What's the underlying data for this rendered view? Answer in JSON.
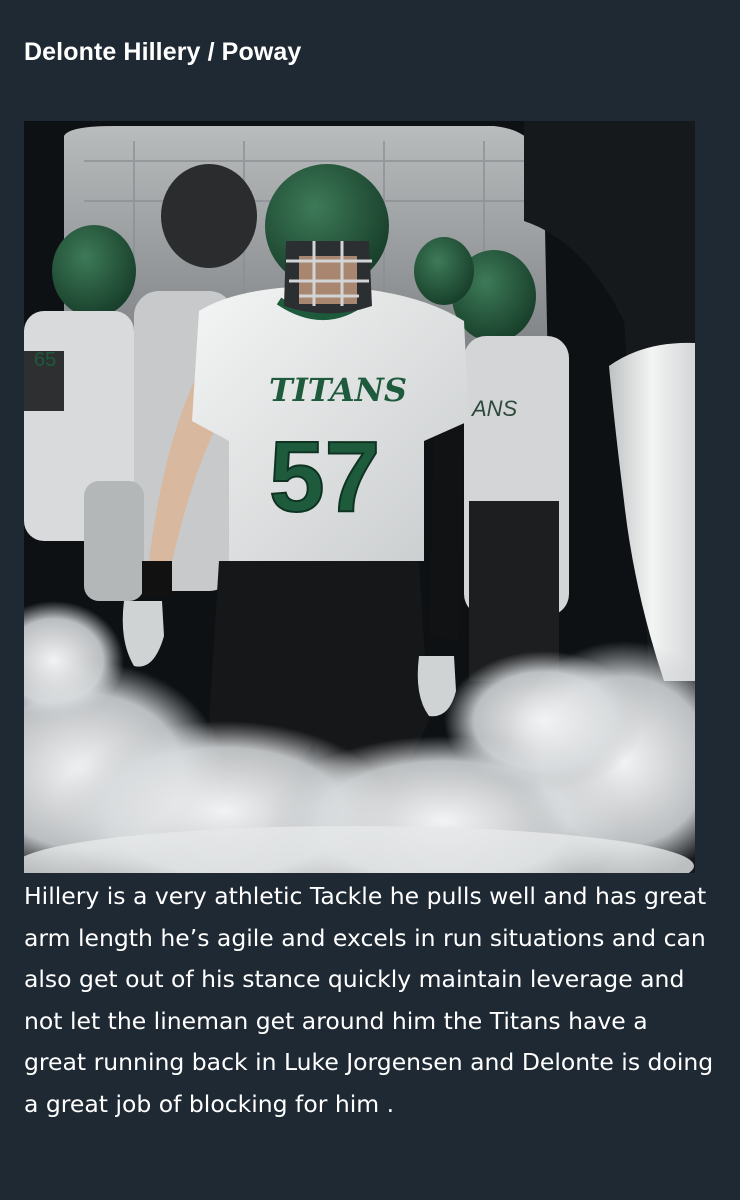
{
  "article": {
    "heading": "Delonte Hillery / Poway",
    "photo": {
      "jersey_text": "TITANS",
      "jersey_number": "57",
      "left_player_number": "65",
      "accent_color": "#1e5a3c"
    },
    "caption": "Hillery is a very athletic Tackle he pulls well and has great arm length he’s agile and excels in run situations and can also get out of his stance quickly maintain leverage and not let the lineman get around him the Titans have a great running back in Luke Jorgensen and Delonte is doing a great job of blocking for him ."
  },
  "theme": {
    "background": "#1f2933",
    "text_color": "#ffffff"
  }
}
